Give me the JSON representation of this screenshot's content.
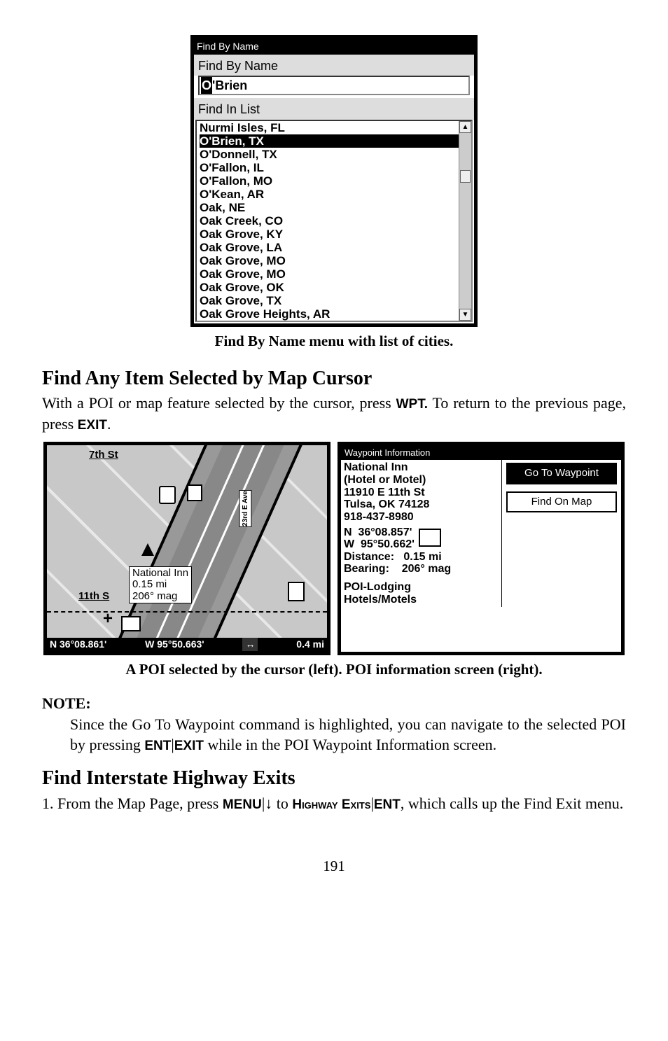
{
  "find_by_name_dialog": {
    "window_title": "Find By Name",
    "section_name_label": "Find By Name",
    "input_value_highlight": "O",
    "input_value_rest": "'Brien",
    "section_list_label": "Find In List",
    "items": [
      "Nurmi Isles, FL",
      "O'Brien, TX",
      "O'Donnell, TX",
      "O'Fallon, IL",
      "O'Fallon, MO",
      "O'Kean, AR",
      "Oak, NE",
      "Oak Creek, CO",
      "Oak Grove, KY",
      "Oak Grove, LA",
      "Oak Grove, MO",
      "Oak Grove, MO",
      "Oak Grove, OK",
      "Oak Grove, TX",
      "Oak Grove Heights, AR"
    ],
    "selected_index": 1
  },
  "caption1": "Find By Name menu with list of cities.",
  "heading1": "Find Any Item Selected by Map Cursor",
  "para1_a": "With a POI or map feature selected by the cursor, press ",
  "para1_key1": "WPT.",
  "para1_b": " To return to the previous page, press ",
  "para1_key2": "EXIT",
  "para1_c": ".",
  "map_panel": {
    "top_label": "7th St",
    "ave_label": "23rd E Ave",
    "poi_name": "National Inn",
    "poi_dist": "0.15 mi",
    "poi_bearing_prefix": "11th S",
    "poi_bearing": "206° mag",
    "status_lat": "N  36°08.861'",
    "status_lon": "W  95°50.663'",
    "status_scale": "0.4 mi"
  },
  "waypoint_panel": {
    "window_title": "Waypoint Information",
    "name": "National Inn",
    "category_line": "(Hotel or Motel)",
    "address": "11910 E 11th St",
    "citystate": "Tulsa, OK 74128",
    "phone": "918-437-8980",
    "lat_label": "N",
    "lat": "36°08.857'",
    "lon_label": "W",
    "lon": "95°50.662'",
    "dist_label": "Distance:",
    "dist": "0.15 mi",
    "brg_label": "Bearing:",
    "brg": "206° mag",
    "poi_cat1": "POI-Lodging",
    "poi_cat2": "Hotels/Motels",
    "btn_go": "Go To Waypoint",
    "btn_find": "Find On Map"
  },
  "caption2": "A POI selected by the cursor (left). POI information screen (right).",
  "note_label": "NOTE:",
  "note_body_a": "Since the Go To Waypoint command is highlighted, you can navigate to the selected POI by pressing ",
  "note_key1": "ENT",
  "note_sep": "|",
  "note_key2": "EXIT",
  "note_body_b": " while in the POI Waypoint Information screen.",
  "heading2": "Find Interstate Highway Exits",
  "para2_a": "1. From the Map Page, press ",
  "para2_key1": "MENU",
  "para2_sep1": "|",
  "para2_arrow": "↓",
  "para2_b": " to ",
  "para2_key2": "Highway Exits",
  "para2_sep2": "|",
  "para2_key3": "ENT",
  "para2_c": ", which calls up the Find Exit menu.",
  "page_number": "191"
}
